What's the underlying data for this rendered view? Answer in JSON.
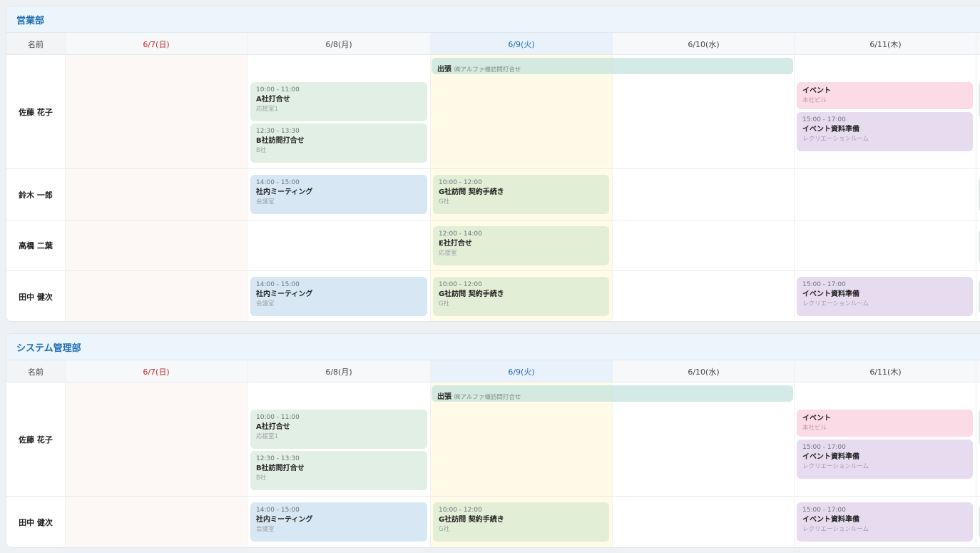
{
  "name_header": "名前",
  "dates": [
    "6/7(日)",
    "6/8(月)",
    "6/9(火)",
    "6/10(水)",
    "6/11(木)"
  ],
  "departments": [
    {
      "title": "営業部",
      "trip": {
        "label": "出張",
        "detail": "㈱アルファ様訪問打合せ"
      },
      "rows": [
        {
          "name": "佐藤 花子"
        },
        {
          "name": "鈴木 一郎"
        },
        {
          "name": "高橋 二葉"
        },
        {
          "name": "田中 健次"
        }
      ],
      "events": [
        {
          "time": "10:00 - 11:00",
          "title": "A社打合せ",
          "location": "応接室1"
        },
        {
          "time": "12:30 - 13:30",
          "title": "B社訪問打合せ",
          "location": "B社"
        },
        {
          "time": "",
          "title": "イベント",
          "location": "本社ビル"
        },
        {
          "time": "15:00 - 17:00",
          "title": "イベント資料準備",
          "location": "レクリエーションルーム"
        },
        {
          "time": "14:00 - 15:00",
          "title": "社内ミーティング",
          "location": "会議室"
        },
        {
          "time": "10:00 - 12:00",
          "title": "G社訪問 契約手続き",
          "location": "G社"
        },
        {
          "time": "12:00 - 14:00",
          "title": "E社打合せ",
          "location": "応接室"
        },
        {
          "time": "14:00 - 15:00",
          "title": "社内ミーティング",
          "location": "会議室"
        },
        {
          "time": "10:00 - 12:00",
          "title": "G社訪問 契約手続き",
          "location": "G社"
        },
        {
          "time": "15:00 - 17:00",
          "title": "イベント資料準備",
          "location": "レクリエーションルーム"
        }
      ]
    },
    {
      "title": "システム管理部",
      "trip": {
        "label": "出張",
        "detail": "㈱アルファ様訪問打合せ"
      },
      "rows": [
        {
          "name": "佐藤 花子"
        },
        {
          "name": "田中 健次"
        }
      ],
      "events": [
        {
          "time": "10:00 - 11:00",
          "title": "A社打合せ",
          "location": "応接室1"
        },
        {
          "time": "12:30 - 13:30",
          "title": "B社訪問打合せ",
          "location": "B社"
        },
        {
          "time": "",
          "title": "イベント",
          "location": "本社ビル"
        },
        {
          "time": "15:00 - 17:00",
          "title": "イベント資料準備",
          "location": "レクリエーションルーム"
        },
        {
          "time": "14:00 - 15:00",
          "title": "社内ミーティング",
          "location": "会議室"
        },
        {
          "time": "10:00 - 12:00",
          "title": "G社訪問 契約手続き",
          "location": "G社"
        },
        {
          "time": "15:00 - 17:00",
          "title": "イベント資料準備",
          "location": "レクリエーションルーム"
        }
      ]
    }
  ],
  "colors": {
    "sunday": "#c62828",
    "today": "#1f6fb3",
    "meeting_green": "#e2efe4",
    "meeting_blue": "#d7e8f4",
    "visit_lime": "#e3eed6",
    "event_pink": "#fbdbe6",
    "prep_purple": "#e7dcef",
    "trip_teal": "#c4e2de"
  }
}
